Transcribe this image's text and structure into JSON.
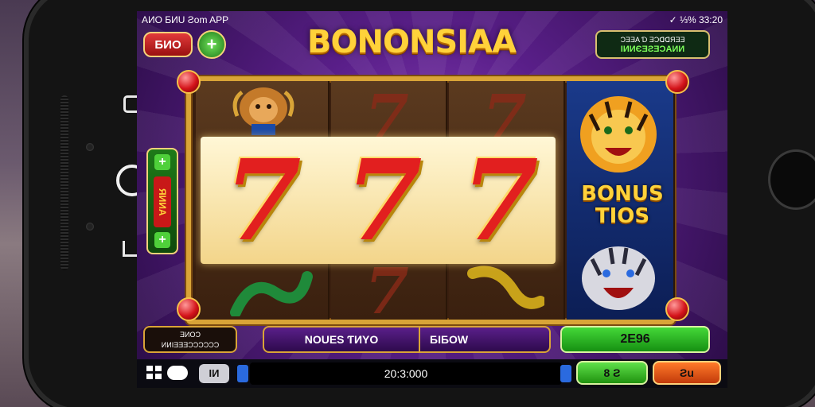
{
  "status_bar": {
    "left_text": "AИO ƂИU Ƨom APP",
    "right_text": "✓ ⅓% 33:20"
  },
  "header": {
    "title": "BONONSIAA",
    "left_button_label": "ƂИO",
    "plus_label": "+",
    "panel_line1": "ƆƎƎA Ɗ ƎƆᗡᗡЯƎƎ",
    "panel_line2": "IИИЄƎƧƎƆAИИ"
  },
  "side_panel": {
    "plus_top": "+",
    "label": "ЯИИA",
    "plus_bottom": "+"
  },
  "reels": {
    "highlight_symbols": [
      "7",
      "7",
      "7"
    ],
    "faded_symbols": [
      "7",
      "7",
      "7",
      "7"
    ],
    "bonus_line1": "BONUS",
    "bonus_line2": "TIOS"
  },
  "bottom_bar": {
    "left_line1": "ƎИOƆ",
    "left_line2": "ИИIƎƎƎƆƆƆƆƆƆ",
    "mid_left": "NOUES ƬИYO",
    "mid_right": "ƂIƂOW",
    "win_value": "2E96"
  },
  "nav_bar": {
    "grey_button": "IИ",
    "balance": "20:3:000",
    "green_button": "8 Ƨ",
    "orange_button": "Ƨu"
  },
  "colors": {
    "title_gold": "#ffd23a",
    "frame_gold": "#d9a437",
    "seven_red": "#e21f1f",
    "win_green": "#44d838",
    "bg_purple": "#5a1f8a"
  }
}
